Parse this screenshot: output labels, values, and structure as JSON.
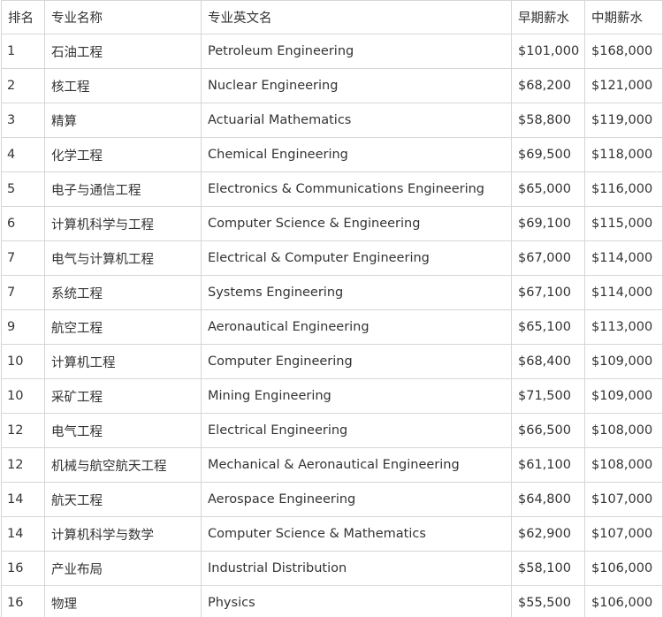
{
  "table": {
    "headers": {
      "rank": "排名",
      "major_cn": "专业名称",
      "major_en": "专业英文名",
      "early_salary": "早期薪水",
      "mid_salary": "中期薪水"
    },
    "rows": [
      {
        "rank": "1",
        "cn": "石油工程",
        "en": "Petroleum Engineering",
        "early": "$101,000",
        "mid": "$168,000"
      },
      {
        "rank": "2",
        "cn": "核工程",
        "en": "Nuclear Engineering",
        "early": "$68,200",
        "mid": "$121,000"
      },
      {
        "rank": "3",
        "cn": "精算",
        "en": "Actuarial Mathematics",
        "early": "$58,800",
        "mid": "$119,000"
      },
      {
        "rank": "4",
        "cn": "化学工程",
        "en": "Chemical Engineering",
        "early": "$69,500",
        "mid": "$118,000"
      },
      {
        "rank": "5",
        "cn": "电子与通信工程",
        "en": "Electronics & Communications Engineering",
        "early": "$65,000",
        "mid": "$116,000"
      },
      {
        "rank": "6",
        "cn": "计算机科学与工程",
        "en": "Computer Science & Engineering",
        "early": "$69,100",
        "mid": "$115,000"
      },
      {
        "rank": "7",
        "cn": "电气与计算机工程",
        "en": "Electrical & Computer Engineering",
        "early": "$67,000",
        "mid": "$114,000"
      },
      {
        "rank": "7",
        "cn": "系统工程",
        "en": "Systems Engineering",
        "early": "$67,100",
        "mid": "$114,000"
      },
      {
        "rank": "9",
        "cn": "航空工程",
        "en": "Aeronautical Engineering",
        "early": "$65,100",
        "mid": "$113,000"
      },
      {
        "rank": "10",
        "cn": "计算机工程",
        "en": "Computer Engineering",
        "early": "$68,400",
        "mid": "$109,000"
      },
      {
        "rank": "10",
        "cn": "采矿工程",
        "en": "Mining Engineering",
        "early": "$71,500",
        "mid": "$109,000"
      },
      {
        "rank": "12",
        "cn": "电气工程",
        "en": "Electrical Engineering",
        "early": "$66,500",
        "mid": "$108,000"
      },
      {
        "rank": "12",
        "cn": "机械与航空航天工程",
        "en": "Mechanical & Aeronautical Engineering",
        "early": "$61,100",
        "mid": "$108,000"
      },
      {
        "rank": "14",
        "cn": "航天工程",
        "en": "Aerospace Engineering",
        "early": "$64,800",
        "mid": "$107,000"
      },
      {
        "rank": "14",
        "cn": "计算机科学与数学",
        "en": "Computer Science & Mathematics",
        "early": "$62,900",
        "mid": "$107,000"
      },
      {
        "rank": "16",
        "cn": "产业布局",
        "en": "Industrial Distribution",
        "early": "$58,100",
        "mid": "$106,000"
      },
      {
        "rank": "16",
        "cn": "物理",
        "en": "Physics",
        "early": "$55,500",
        "mid": "$106,000"
      }
    ]
  }
}
